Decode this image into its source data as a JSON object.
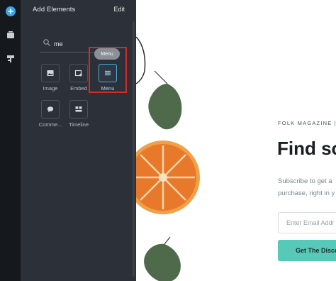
{
  "rail": {
    "icons": [
      "add-icon",
      "pages-icon",
      "layout-icon"
    ],
    "accent": "#3aa6e5"
  },
  "panel": {
    "title": "Add Elements",
    "edit_label": "Edit",
    "search": {
      "value": "me",
      "placeholder": ""
    },
    "elements": [
      {
        "label": "Image",
        "icon": "image-icon"
      },
      {
        "label": "Embed",
        "icon": "embed-icon"
      },
      {
        "label": "Menu",
        "icon": "menu-icon"
      },
      {
        "label": "Comme...",
        "icon": "comments-icon"
      },
      {
        "label": "Timeline",
        "icon": "timeline-icon"
      }
    ],
    "selected": "Menu",
    "tooltip": "Menu",
    "highlight_color": "#d12b2b"
  },
  "preview": {
    "magazine_label": "FOLK MAGAZINE | O",
    "headline": "Find so",
    "subcopy_line1": "Subscribe to get a",
    "subcopy_line2": "purchase, right in y",
    "email_placeholder": "Enter Email Addr",
    "cta_label": "Get The Disco",
    "cta_color": "#57c9b8"
  }
}
